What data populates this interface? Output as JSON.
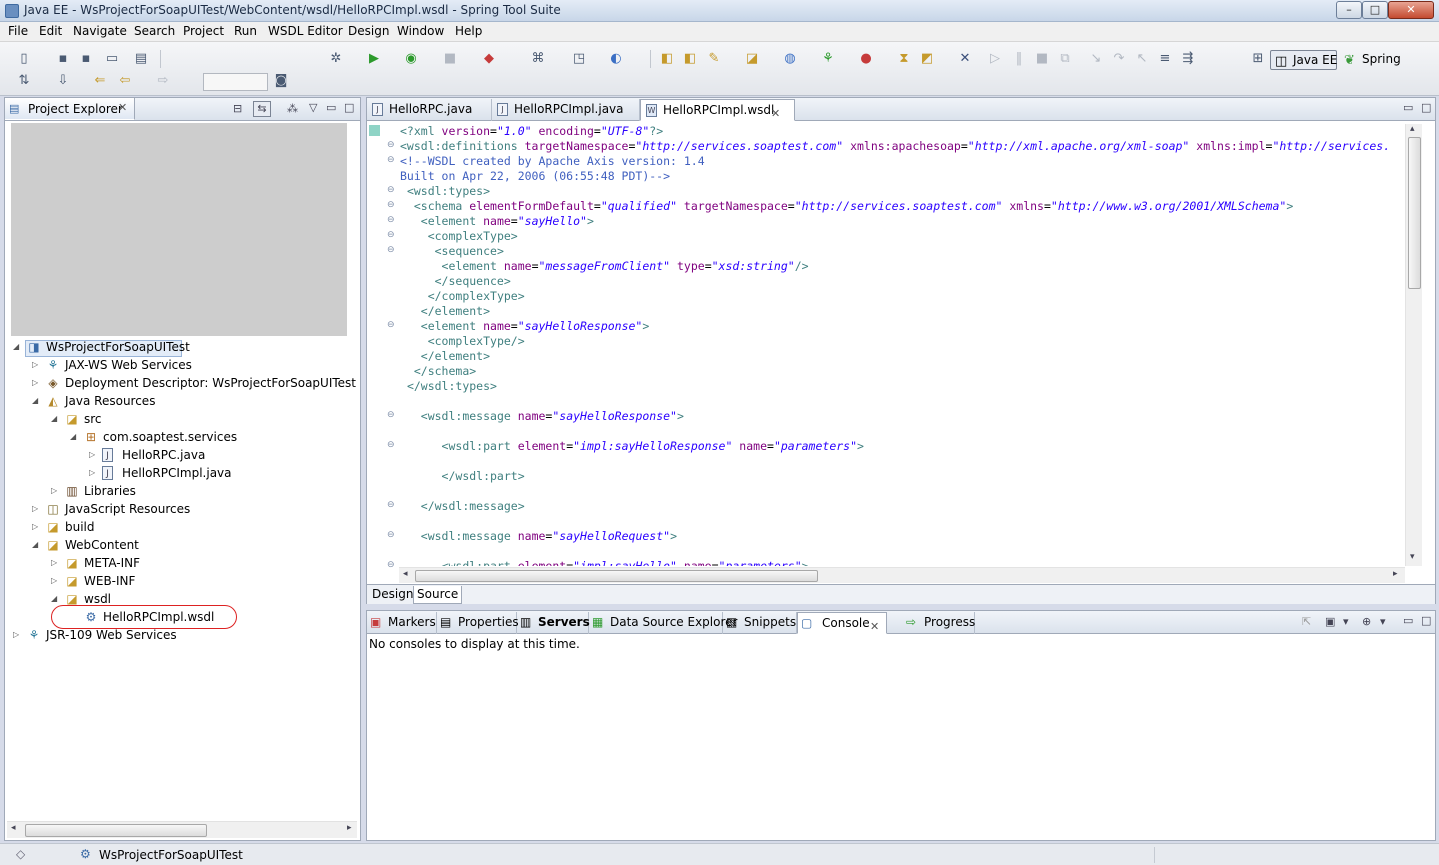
{
  "window": {
    "title": "Java EE - WsProjectForSoapUITest/WebContent/wsdl/HelloRPCImpl.wsdl - Spring Tool Suite",
    "minimize_glyph": "–",
    "maximize_glyph": "□",
    "close_glyph": "✕"
  },
  "menu": [
    "File",
    "Edit",
    "Navigate",
    "Search",
    "Project",
    "Run",
    "WSDL Editor",
    "Design",
    "Window",
    "Help"
  ],
  "perspectives": {
    "javaee": "Java EE",
    "spring": "Spring"
  },
  "project_explorer": {
    "title": "Project Explorer",
    "tree": [
      {
        "label": "WsProjectForSoapUITest",
        "icon": "project-icon",
        "expanded": true,
        "selected": true
      },
      {
        "label": "JAX-WS Web Services",
        "icon": "webservice-icon",
        "expanded": false
      },
      {
        "label": "Deployment Descriptor: WsProjectForSoapUITest",
        "icon": "descriptor-icon",
        "expanded": false
      },
      {
        "label": "Java Resources",
        "icon": "java-resources-icon",
        "expanded": true
      },
      {
        "label": "src",
        "icon": "source-folder-icon",
        "expanded": true
      },
      {
        "label": "com.soaptest.services",
        "icon": "package-icon",
        "expanded": true
      },
      {
        "label": "HelloRPC.java",
        "icon": "java-file-icon",
        "expanded": false
      },
      {
        "label": "HelloRPCImpl.java",
        "icon": "java-file-icon",
        "expanded": false
      },
      {
        "label": "Libraries",
        "icon": "library-icon",
        "expanded": false
      },
      {
        "label": "JavaScript Resources",
        "icon": "javascript-icon",
        "expanded": false
      },
      {
        "label": "build",
        "icon": "folder-icon",
        "expanded": false
      },
      {
        "label": "WebContent",
        "icon": "folder-icon",
        "expanded": true
      },
      {
        "label": "META-INF",
        "icon": "folder-icon",
        "expanded": false
      },
      {
        "label": "WEB-INF",
        "icon": "folder-icon",
        "expanded": false
      },
      {
        "label": "wsdl",
        "icon": "folder-icon",
        "expanded": true
      },
      {
        "label": "HelloRPCImpl.wsdl",
        "icon": "wsdl-file-icon",
        "expanded": false
      },
      {
        "label": "JSR-109 Web Services",
        "icon": "webservice-icon",
        "expanded": false
      }
    ]
  },
  "editor": {
    "tabs": [
      {
        "label": "HelloRPC.java",
        "active": false
      },
      {
        "label": "HelloRPCImpl.java",
        "active": false
      },
      {
        "label": "HelloRPCImpl.wsdl",
        "active": true
      }
    ],
    "subtabs": [
      {
        "label": "Design",
        "active": false
      },
      {
        "label": "Source",
        "active": true
      }
    ],
    "code_lines": [
      "<?xml version=\"1.0\" encoding=\"UTF-8\"?>",
      "<wsdl:definitions targetNamespace=\"http://services.soaptest.com\" xmlns:apachesoap=\"http://xml.apache.org/xml-soap\" xmlns:impl=\"http://services.",
      "<!--WSDL created by Apache Axis version: 1.4",
      "Built on Apr 22, 2006 (06:55:48 PDT)-->",
      " <wsdl:types>",
      "  <schema elementFormDefault=\"qualified\" targetNamespace=\"http://services.soaptest.com\" xmlns=\"http://www.w3.org/2001/XMLSchema\">",
      "   <element name=\"sayHello\">",
      "    <complexType>",
      "     <sequence>",
      "      <element name=\"messageFromClient\" type=\"xsd:string\"/>",
      "     </sequence>",
      "    </complexType>",
      "   </element>",
      "   <element name=\"sayHelloResponse\">",
      "    <complexType/>",
      "   </element>",
      "  </schema>",
      " </wsdl:types>",
      "",
      "   <wsdl:message name=\"sayHelloResponse\">",
      "",
      "      <wsdl:part element=\"impl:sayHelloResponse\" name=\"parameters\">",
      "",
      "      </wsdl:part>",
      "",
      "   </wsdl:message>",
      "",
      "   <wsdl:message name=\"sayHelloRequest\">",
      "",
      "      <wsdl:part element=\"impl:sayHello\" name=\"parameters\">"
    ]
  },
  "bottom_panel": {
    "tabs": [
      {
        "label": "Markers",
        "icon": "markers-icon",
        "active": false
      },
      {
        "label": "Properties",
        "icon": "properties-icon",
        "active": false
      },
      {
        "label": "Servers",
        "icon": "servers-icon",
        "active": false
      },
      {
        "label": "Data Source Explorer",
        "icon": "datasource-icon",
        "active": false
      },
      {
        "label": "Snippets",
        "icon": "snippets-icon",
        "active": false
      },
      {
        "label": "Console",
        "icon": "console-icon",
        "active": true
      },
      {
        "label": "Progress",
        "icon": "progress-icon",
        "active": false
      }
    ],
    "message": "No consoles to display at this time."
  },
  "status_bar": {
    "text": "WsProjectForSoapUITest"
  }
}
